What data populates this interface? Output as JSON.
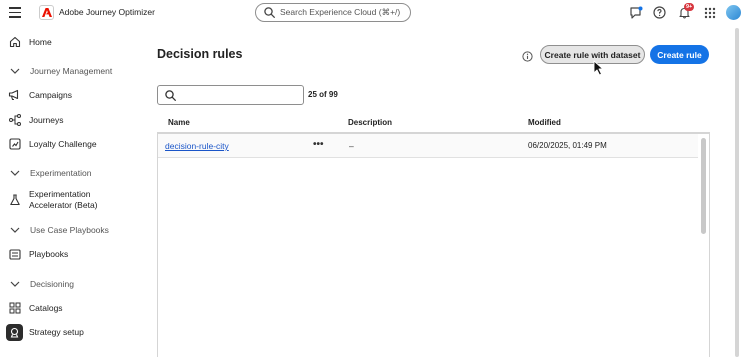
{
  "app": {
    "title": "Adobe Journey Optimizer",
    "search_placeholder": "Search Experience Cloud (⌘+/)",
    "notification_count": "9+"
  },
  "sidebar": {
    "items": [
      {
        "label": "Home",
        "icon": "home-icon"
      },
      {
        "label": "Journey Management",
        "section": true
      },
      {
        "label": "Campaigns",
        "icon": "megaphone-icon"
      },
      {
        "label": "Journeys",
        "icon": "journey-icon"
      },
      {
        "label": "Loyalty Challenge",
        "icon": "challenge-icon"
      },
      {
        "label": "Experimentation",
        "section": true
      },
      {
        "label": "Experimentation Accelerator (Beta)",
        "icon": "flask-icon"
      },
      {
        "label": "Use Case Playbooks",
        "section": true
      },
      {
        "label": "Playbooks",
        "icon": "playbook-icon"
      },
      {
        "label": "Decisioning",
        "section": true
      },
      {
        "label": "Catalogs",
        "icon": "catalog-icon"
      },
      {
        "label": "Strategy setup",
        "icon": "strategy-icon",
        "active": true
      }
    ]
  },
  "main": {
    "title": "Decision rules",
    "create_with_dataset_label": "Create rule with dataset",
    "create_label": "Create rule",
    "filter_value": "",
    "count": "25 of 99",
    "columns": [
      "Name",
      "Description",
      "Modified"
    ],
    "rows": [
      {
        "name": "decision-rule-city",
        "more": "•••",
        "description": "–",
        "modified": "06/20/2025, 01:49 PM"
      }
    ]
  },
  "colors": {
    "accent": "#1473e6",
    "link": "#1a55c8",
    "badge": "#d7373f"
  }
}
